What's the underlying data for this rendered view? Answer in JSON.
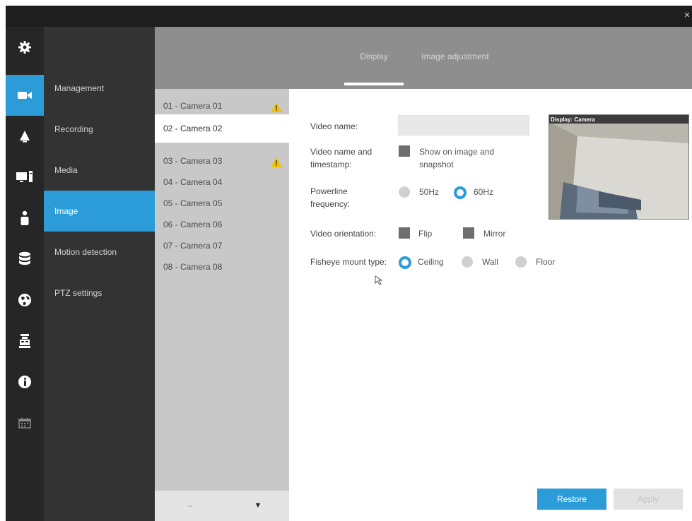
{
  "window": {
    "close_glyph": "×"
  },
  "rail": {
    "items": [
      {
        "icon": "gear-icon",
        "active": false
      },
      {
        "icon": "camera-icon",
        "active": true
      },
      {
        "icon": "alarm-bell-icon",
        "active": false
      },
      {
        "icon": "monitor-icon",
        "active": false
      },
      {
        "icon": "user-icon",
        "active": false
      },
      {
        "icon": "storage-database-icon",
        "active": false
      },
      {
        "icon": "network-globe-icon",
        "active": false
      },
      {
        "icon": "system-icon",
        "active": false
      },
      {
        "icon": "info-icon",
        "active": false
      },
      {
        "icon": "calendar-icon",
        "active": false
      }
    ]
  },
  "menu": {
    "items": [
      {
        "label": "Management"
      },
      {
        "label": "Recording"
      },
      {
        "label": "Media"
      },
      {
        "label": "Image",
        "active": true
      },
      {
        "label": "Motion detection"
      },
      {
        "label": "PTZ settings"
      }
    ]
  },
  "tabs": {
    "items": [
      {
        "label": "Display",
        "active": true
      },
      {
        "label": "Image adjustment"
      }
    ]
  },
  "cameras": {
    "items": [
      {
        "label": "01 - Camera 01",
        "warning": true
      },
      {
        "label": "02 - Camera 02",
        "active": true
      },
      {
        "label": "03 - Camera 03",
        "warning": true
      },
      {
        "label": "04 - Camera 04"
      },
      {
        "label": "05 - Camera 05"
      },
      {
        "label": "06 - Camera 06"
      },
      {
        "label": "07 - Camera 07"
      },
      {
        "label": "08 - Camera 08"
      }
    ],
    "prev_glyph": "–",
    "next_glyph": "▼"
  },
  "settings": {
    "video_name": {
      "label": "Video name:",
      "value": ""
    },
    "name_timestamp": {
      "label_line1": "Video name and",
      "label_line2": "timestamp:",
      "option_line1": "Show on image and",
      "option_line2": "snapshot"
    },
    "powerline": {
      "label_line1": "Powerline",
      "label_line2": "frequency:",
      "options": [
        "50Hz",
        "60Hz"
      ],
      "selected": "60Hz"
    },
    "orientation": {
      "label": "Video orientation:",
      "options": [
        "Flip",
        "Mirror"
      ]
    },
    "fisheye": {
      "label": "Fisheye mount type:",
      "options": [
        "Ceiling",
        "Wall",
        "Floor"
      ],
      "selected": "Ceiling"
    }
  },
  "preview": {
    "overlay_text": "Display: Camera"
  },
  "buttons": {
    "restore": "Restore",
    "apply": "Apply"
  },
  "colors": {
    "accent": "#2b9cd8",
    "rail_bg": "#262626",
    "menu_bg": "#333333",
    "tabbar_bg": "#8e8e8e",
    "camlist_bg": "#c8c8c8",
    "warning": "#f2c200"
  }
}
